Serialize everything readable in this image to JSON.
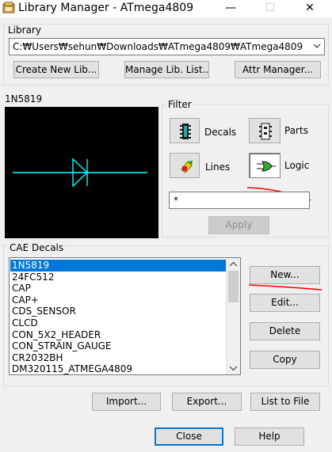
{
  "window": {
    "title": "Library Manager - ATmega4809",
    "minimize_glyph": "—",
    "maximize_glyph": "☐",
    "close_glyph": "✕"
  },
  "library": {
    "group_label": "Library",
    "path": "C:₩Users₩sehun₩Downloads₩ATmega4809₩ATmega4809",
    "buttons": {
      "create": "Create New Lib...",
      "manage": "Manage Lib. List...",
      "attr": "Attr Manager..."
    }
  },
  "preview": {
    "part_name": "1N5819",
    "trace_color": "#00ffff"
  },
  "filter": {
    "group_label": "Filter",
    "decals_label": "Decals",
    "parts_label": "Parts",
    "lines_label": "Lines",
    "logic_label": "Logic",
    "filter_value": "*",
    "apply_label": "Apply"
  },
  "cae": {
    "group_label": "CAE Decals",
    "items": [
      "1N5819",
      "24FC512",
      "CAP",
      "CAP+",
      "CDS_SENSOR",
      "CLCD",
      "CON_5X2_HEADER",
      "CON_STRAIN_GAUGE",
      "CR2032BH",
      "DM320115_ATMEGA4809"
    ],
    "selected_index": 0,
    "buttons": {
      "new": "New...",
      "edit": "Edit...",
      "delete": "Delete",
      "copy": "Copy"
    }
  },
  "bottom": {
    "import": "Import...",
    "export": "Export...",
    "list_to_file": "List to File",
    "close": "Close",
    "help": "Help"
  },
  "colors": {
    "annotation_red": "#ff0000",
    "selection_blue": "#0078d7"
  }
}
